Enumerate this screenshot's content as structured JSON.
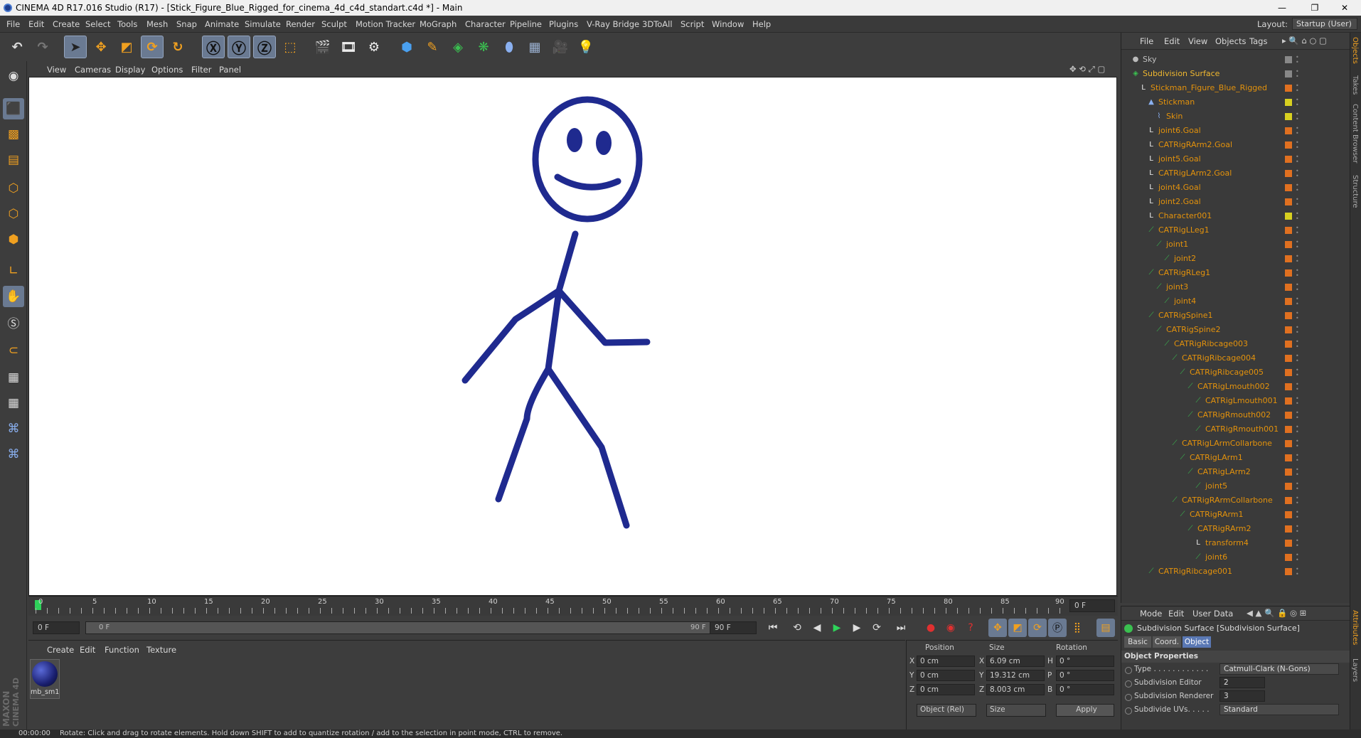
{
  "title_bar": {
    "title": "CINEMA 4D R17.016 Studio (R17) - [Stick_Figure_Blue_Rigged_for_cinema_4d_c4d_standart.c4d *] - Main",
    "minimize": "—",
    "maximize": "❐",
    "close": "✕"
  },
  "menu": {
    "items": [
      "File",
      "Edit",
      "Create",
      "Select",
      "Tools",
      "Mesh",
      "Snap",
      "Animate",
      "Simulate",
      "Render",
      "Sculpt",
      "Motion Tracker",
      "MoGraph",
      "Character",
      "Pipeline",
      "Plugins",
      "V-Ray Bridge",
      "3DToAll",
      "Script",
      "Window",
      "Help"
    ],
    "layout_label": "Layout:",
    "layout_value": "Startup (User)"
  },
  "viewport": {
    "menu": [
      "View",
      "Cameras",
      "Display",
      "Options",
      "Filter",
      "Panel"
    ],
    "figure_color": "#1f2a8f"
  },
  "timeline": {
    "ticks": [
      "0",
      "5",
      "10",
      "15",
      "20",
      "25",
      "30",
      "35",
      "40",
      "45",
      "50",
      "55",
      "60",
      "65",
      "70",
      "75",
      "80",
      "85",
      "90"
    ],
    "current_frame": "0 F"
  },
  "transport": {
    "start": "0 F",
    "range_start": "0 F",
    "range_end": "90 F",
    "end": "90 F"
  },
  "material_panel": {
    "menu": [
      "Create",
      "Edit",
      "Function",
      "Texture"
    ],
    "material_name": "mb_sm1",
    "logo_top": "MAXON",
    "logo_bottom": "CINEMA 4D"
  },
  "coords": {
    "headers": [
      "Position",
      "Size",
      "Rotation"
    ],
    "rows": [
      {
        "axis": "X",
        "pos": "0 cm",
        "saxis": "X",
        "size": "6.09 cm",
        "raxis": "H",
        "rot": "0 °"
      },
      {
        "axis": "Y",
        "pos": "0 cm",
        "saxis": "Y",
        "size": "19.312 cm",
        "raxis": "P",
        "rot": "0 °"
      },
      {
        "axis": "Z",
        "pos": "0 cm",
        "saxis": "Z",
        "size": "8.003 cm",
        "raxis": "B",
        "rot": "0 °"
      }
    ],
    "mode_dropdown": "Object (Rel)",
    "size_dropdown": "Size",
    "apply_label": "Apply"
  },
  "status": {
    "time": "00:00:00",
    "message": "Rotate: Click and drag to rotate elements. Hold down SHIFT to add to quantize rotation / add to the selection in point mode, CTRL to remove."
  },
  "object_manager": {
    "menu": [
      "File",
      "Edit",
      "View",
      "Objects",
      "Tags"
    ],
    "items": [
      {
        "label": "Sky",
        "depth": 0,
        "icon": "sky",
        "color": "#c0c0c0"
      },
      {
        "label": "Subdivision Surface",
        "depth": 0,
        "icon": "subd",
        "color": "#f0b830"
      },
      {
        "label": "Stickman_Figure_Blue_Rigged",
        "depth": 1,
        "icon": "null",
        "color": "#e3920c"
      },
      {
        "label": "Stickman",
        "depth": 2,
        "icon": "poly",
        "color": "#e3920c"
      },
      {
        "label": "Skin",
        "depth": 3,
        "icon": "skin",
        "color": "#e3920c"
      },
      {
        "label": "joint6.Goal",
        "depth": 2,
        "icon": "null",
        "color": "#e3920c"
      },
      {
        "label": "CATRigRArm2.Goal",
        "depth": 2,
        "icon": "null",
        "color": "#e3920c"
      },
      {
        "label": "joint5.Goal",
        "depth": 2,
        "icon": "null",
        "color": "#e3920c"
      },
      {
        "label": "CATRigLArm2.Goal",
        "depth": 2,
        "icon": "null",
        "color": "#e3920c"
      },
      {
        "label": "joint4.Goal",
        "depth": 2,
        "icon": "null",
        "color": "#e3920c"
      },
      {
        "label": "joint2.Goal",
        "depth": 2,
        "icon": "null",
        "color": "#e3920c"
      },
      {
        "label": "Character001",
        "depth": 2,
        "icon": "null",
        "color": "#e3920c"
      },
      {
        "label": "CATRigLLeg1",
        "depth": 2,
        "icon": "joint",
        "color": "#e3920c"
      },
      {
        "label": "joint1",
        "depth": 3,
        "icon": "joint",
        "color": "#e3920c"
      },
      {
        "label": "joint2",
        "depth": 4,
        "icon": "joint",
        "color": "#e3920c"
      },
      {
        "label": "CATRigRLeg1",
        "depth": 2,
        "icon": "joint",
        "color": "#e3920c"
      },
      {
        "label": "joint3",
        "depth": 3,
        "icon": "joint",
        "color": "#e3920c"
      },
      {
        "label": "joint4",
        "depth": 4,
        "icon": "joint",
        "color": "#e3920c"
      },
      {
        "label": "CATRigSpine1",
        "depth": 2,
        "icon": "joint",
        "color": "#e3920c"
      },
      {
        "label": "CATRigSpine2",
        "depth": 3,
        "icon": "joint",
        "color": "#e3920c"
      },
      {
        "label": "CATRigRibcage003",
        "depth": 4,
        "icon": "joint",
        "color": "#e3920c"
      },
      {
        "label": "CATRigRibcage004",
        "depth": 5,
        "icon": "joint",
        "color": "#e3920c"
      },
      {
        "label": "CATRigRibcage005",
        "depth": 6,
        "icon": "joint",
        "color": "#e3920c"
      },
      {
        "label": "CATRigLmouth002",
        "depth": 7,
        "icon": "joint",
        "color": "#e3920c"
      },
      {
        "label": "CATRigLmouth001",
        "depth": 8,
        "icon": "joint",
        "color": "#e3920c"
      },
      {
        "label": "CATRigRmouth002",
        "depth": 7,
        "icon": "joint",
        "color": "#e3920c"
      },
      {
        "label": "CATRigRmouth001",
        "depth": 8,
        "icon": "joint",
        "color": "#e3920c"
      },
      {
        "label": "CATRigLArmCollarbone",
        "depth": 5,
        "icon": "joint",
        "color": "#e3920c"
      },
      {
        "label": "CATRigLArm1",
        "depth": 6,
        "icon": "joint",
        "color": "#e3920c"
      },
      {
        "label": "CATRigLArm2",
        "depth": 7,
        "icon": "joint",
        "color": "#e3920c"
      },
      {
        "label": "joint5",
        "depth": 8,
        "icon": "joint",
        "color": "#e3920c"
      },
      {
        "label": "CATRigRArmCollarbone",
        "depth": 5,
        "icon": "joint",
        "color": "#e3920c"
      },
      {
        "label": "CATRigRArm1",
        "depth": 6,
        "icon": "joint",
        "color": "#e3920c"
      },
      {
        "label": "CATRigRArm2",
        "depth": 7,
        "icon": "joint",
        "color": "#e3920c"
      },
      {
        "label": "transform4",
        "depth": 8,
        "icon": "null",
        "color": "#e3920c"
      },
      {
        "label": "joint6",
        "depth": 8,
        "icon": "joint",
        "color": "#e3920c"
      },
      {
        "label": "CATRigRibcage001",
        "depth": 2,
        "icon": "joint",
        "color": "#e3920c"
      }
    ]
  },
  "attributes": {
    "menu": [
      "Mode",
      "Edit",
      "User Data"
    ],
    "title": "Subdivision Surface [Subdivision Surface]",
    "tabs": [
      "Basic",
      "Coord.",
      "Object"
    ],
    "active_tab": "Object",
    "section": "Object Properties",
    "props": [
      {
        "label": "Type . . . . . . . . . . . .",
        "value": "Catmull-Clark (N-Gons)",
        "kind": "dropdown"
      },
      {
        "label": "Subdivision Editor",
        "value": "2",
        "kind": "number"
      },
      {
        "label": "Subdivision Renderer",
        "value": "3",
        "kind": "number"
      },
      {
        "label": "Subdivide UVs. . . . .",
        "value": "Standard",
        "kind": "dropdown"
      }
    ]
  },
  "right_tabs": [
    "Objects",
    "Takes",
    "Content Browser",
    "Structure",
    "Attributes",
    "Layers"
  ]
}
